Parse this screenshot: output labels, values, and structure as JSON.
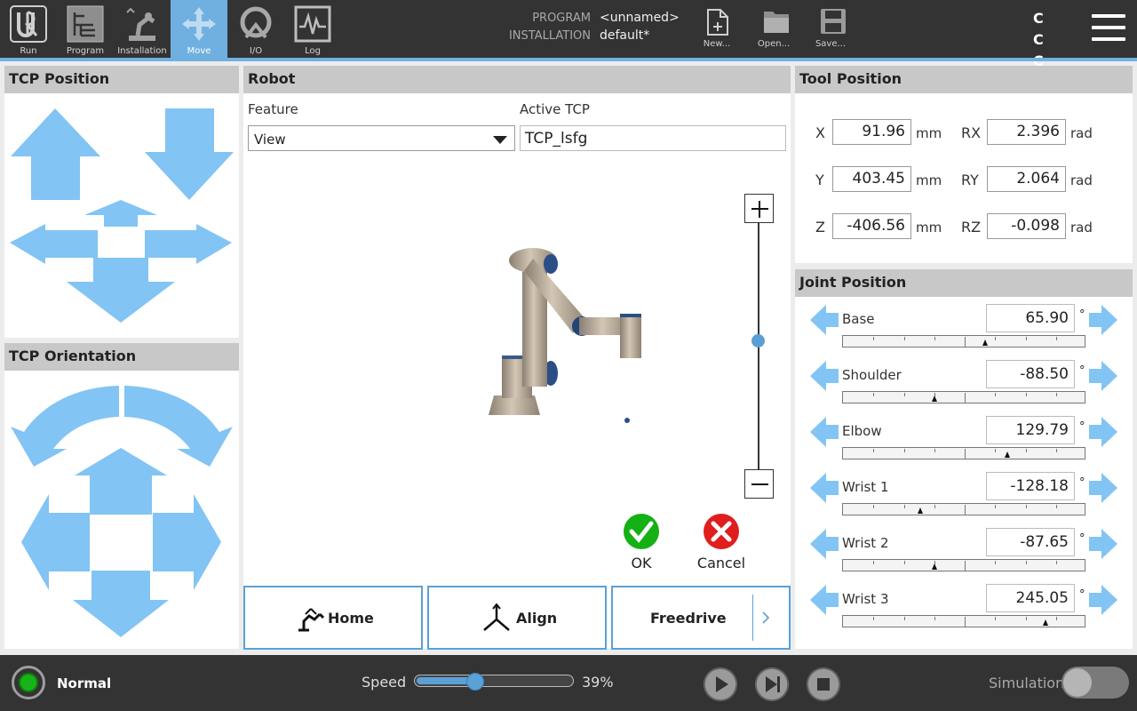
{
  "nav": {
    "tabs": [
      {
        "label": "Run",
        "icon": "ur-logo-icon"
      },
      {
        "label": "Program",
        "icon": "program-icon"
      },
      {
        "label": "Installation",
        "icon": "installation-icon"
      },
      {
        "label": "Move",
        "icon": "move-icon",
        "active": true
      },
      {
        "label": "I/O",
        "icon": "io-icon"
      },
      {
        "label": "Log",
        "icon": "log-icon"
      }
    ]
  },
  "program": {
    "program_label": "PROGRAM",
    "program_value": "<unnamed>",
    "installation_label": "INSTALLATION",
    "installation_value": "default*"
  },
  "file_actions": {
    "new_label": "New...",
    "open_label": "Open...",
    "save_label": "Save..."
  },
  "header_right": {
    "cc_text": "C C C C"
  },
  "tcp_position": {
    "title": "TCP Position"
  },
  "tcp_orientation": {
    "title": "TCP Orientation"
  },
  "robot": {
    "title": "Robot",
    "feature_label": "Feature",
    "feature_value": "View",
    "active_tcp_label": "Active TCP",
    "active_tcp_value": "TCP_lsfg",
    "ok_label": "OK",
    "cancel_label": "Cancel",
    "home_label": "Home",
    "align_label": "Align",
    "freedrive_label": "Freedrive"
  },
  "tool_position": {
    "title": "Tool Position",
    "x_label": "X",
    "x_value": "91.96",
    "x_unit": "mm",
    "y_label": "Y",
    "y_value": "403.45",
    "y_unit": "mm",
    "z_label": "Z",
    "z_value": "-406.56",
    "z_unit": "mm",
    "rx_label": "RX",
    "rx_value": "2.396",
    "rx_unit": "rad",
    "ry_label": "RY",
    "ry_value": "2.064",
    "ry_unit": "rad",
    "rz_label": "RZ",
    "rz_value": "-0.098",
    "rz_unit": "rad"
  },
  "joint_position": {
    "title": "Joint Position",
    "unit": "°",
    "joints": [
      {
        "name": "Base",
        "value": "65.90",
        "fraction": 0.59
      },
      {
        "name": "Shoulder",
        "value": "-88.50",
        "fraction": 0.38
      },
      {
        "name": "Elbow",
        "value": "129.79",
        "fraction": 0.68
      },
      {
        "name": "Wrist 1",
        "value": "-128.18",
        "fraction": 0.32
      },
      {
        "name": "Wrist 2",
        "value": "-87.65",
        "fraction": 0.38
      },
      {
        "name": "Wrist 3",
        "value": "245.05",
        "fraction": 0.84
      }
    ]
  },
  "footer": {
    "status_label": "Normal",
    "status_color": "#18b318",
    "speed_label": "Speed",
    "speed_value": "39%",
    "speed_fraction": 0.39,
    "simulation_label": "Simulation",
    "simulation_on": false
  },
  "colors": {
    "accent": "#6fb0e0",
    "arrow": "#82c4f4",
    "topbar": "#333333"
  }
}
